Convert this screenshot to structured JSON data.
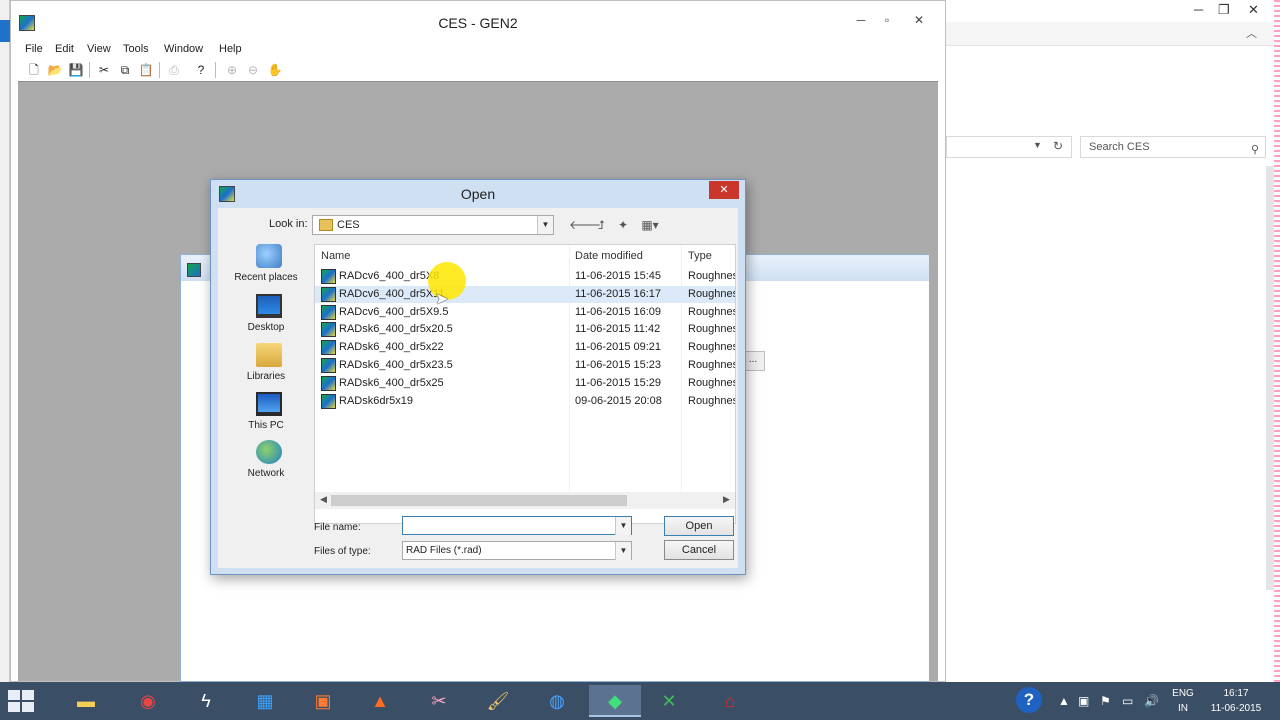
{
  "app": {
    "title": "CES - GEN2",
    "menu": [
      "File",
      "Edit",
      "View",
      "Tools",
      "Window",
      "Help"
    ]
  },
  "background_window": {
    "search_placeholder": "Search CES",
    "minimize": "─",
    "restore": "❐",
    "close": "✕"
  },
  "child_window": {
    "ellipsis": "..."
  },
  "dialog": {
    "title": "Open",
    "look_in_label": "Look in:",
    "look_in_value": "CES",
    "places": [
      {
        "label": "Recent places"
      },
      {
        "label": "Desktop"
      },
      {
        "label": "Libraries"
      },
      {
        "label": "This PC"
      },
      {
        "label": "Network"
      }
    ],
    "columns": {
      "name": "Name",
      "date": "Date modified",
      "type": "Type"
    },
    "files": [
      {
        "name": "RADcv6_400_dr5X8",
        "date": "11-06-2015 15:45",
        "type": "Roughnes"
      },
      {
        "name": "RADcv6_400_dr5X11",
        "date": "11-06-2015 16:17",
        "type": "Roughnes"
      },
      {
        "name": "RADcv6_400_dr5X9.5",
        "date": "11-06-2015 16:09",
        "type": "Roughnes"
      },
      {
        "name": "RADsk6_400_dr5x20.5",
        "date": "11-06-2015 11:42",
        "type": "Roughnes"
      },
      {
        "name": "RADsk6_400_dr5x22",
        "date": "11-06-2015 09:21",
        "type": "Roughnes"
      },
      {
        "name": "RADsk6_400_dr5x23.5",
        "date": "11-06-2015 15:23",
        "type": "Roughnes"
      },
      {
        "name": "RADsk6_400_dr5x25",
        "date": "11-06-2015 15:29",
        "type": "Roughnes"
      },
      {
        "name": "RADsk6dr5x19",
        "date": "09-06-2015 20:08",
        "type": "Roughnes"
      }
    ],
    "selected_index": 1,
    "file_name_label": "File name:",
    "file_name_value": "",
    "files_of_type_label": "Files of type:",
    "files_of_type_value": "RAD Files (*.rad)",
    "open_button": "Open",
    "cancel_button": "Cancel"
  },
  "taskbar": {
    "language_top": "ENG",
    "language_bottom": "IN",
    "time": "16:17",
    "date": "11-06-2015"
  },
  "colors": {
    "dialog_frame": "#cfe0f3",
    "selection": "#dbe9f8",
    "taskbar": "#3a4e66",
    "close_red": "#c9372c",
    "workspace": "#ababab"
  }
}
